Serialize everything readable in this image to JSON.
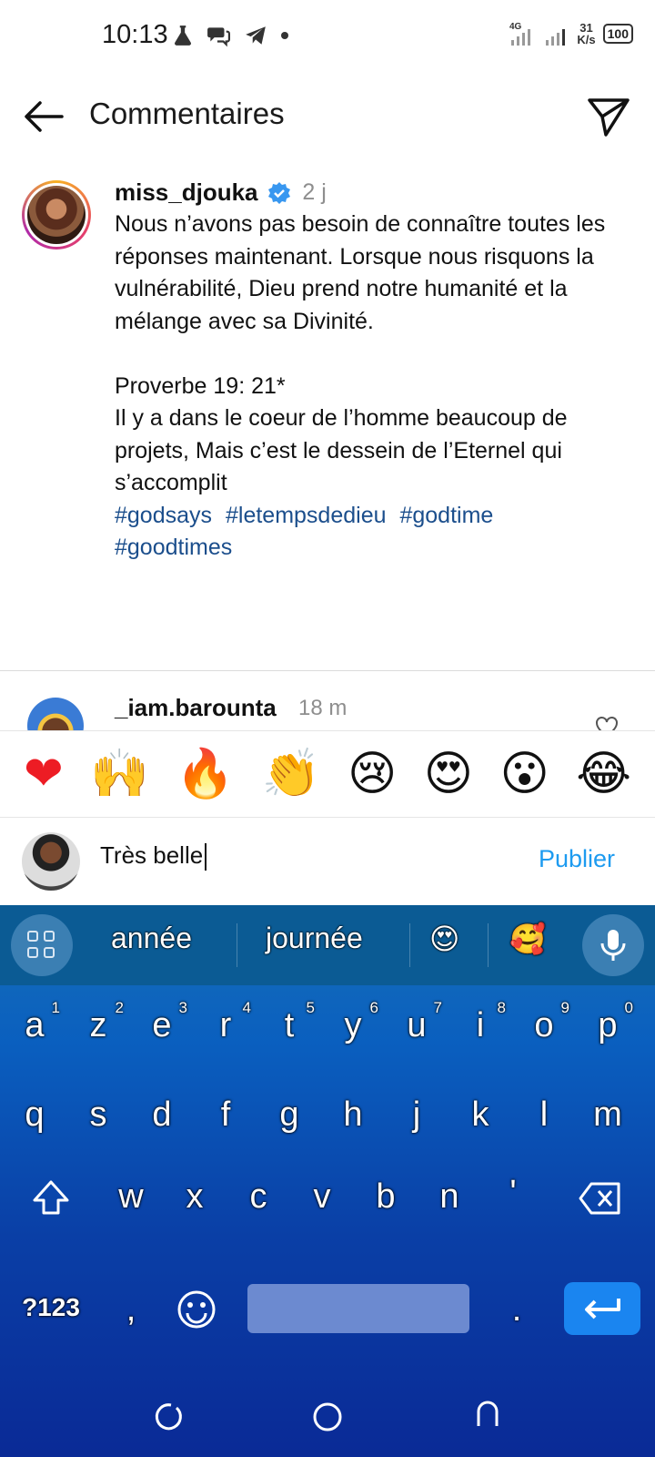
{
  "status": {
    "time": "10:13",
    "net_speed_value": "31",
    "net_speed_unit": "K/s",
    "signal_label": "4G",
    "battery": "100"
  },
  "header": {
    "title": "Commentaires"
  },
  "caption": {
    "username": "miss_djouka",
    "time": "2 j",
    "text": "Nous n’avons pas besoin de connaître toutes les réponses maintenant. Lorsque nous risquons la vulnérabilité, Dieu prend notre humanité et la mélange avec sa Divinité.\n\nProverbe 19: 21*\nIl y a dans le coeur de l’homme beaucoup de projets, Mais c’est le dessein de l’Eternel qui s’accomplit\n",
    "hashtags": [
      "#godsays",
      "#letempsdedieu",
      "#godtime",
      "#goodtimes"
    ]
  },
  "comment2": {
    "username": "_iam.barounta",
    "time": "18 m"
  },
  "emoji_bar": [
    "❤",
    "🙌",
    "🔥",
    "👏",
    "😢",
    "😍",
    "😮",
    "😂"
  ],
  "input": {
    "value": "Très belle",
    "publish_label": "Publier"
  },
  "keyboard": {
    "suggestions": [
      "année",
      "journée",
      "😍",
      "🥰"
    ],
    "row1": [
      {
        "k": "a",
        "n": "1"
      },
      {
        "k": "z",
        "n": "2"
      },
      {
        "k": "e",
        "n": "3"
      },
      {
        "k": "r",
        "n": "4"
      },
      {
        "k": "t",
        "n": "5"
      },
      {
        "k": "y",
        "n": "6"
      },
      {
        "k": "u",
        "n": "7"
      },
      {
        "k": "i",
        "n": "8"
      },
      {
        "k": "o",
        "n": "9"
      },
      {
        "k": "p",
        "n": "0"
      }
    ],
    "row2": [
      "q",
      "s",
      "d",
      "f",
      "g",
      "h",
      "j",
      "k",
      "l",
      "m"
    ],
    "row3": [
      "w",
      "x",
      "c",
      "v",
      "b",
      "n",
      "'"
    ],
    "symbols_label": "?123",
    "comma": ",",
    "period": "."
  }
}
